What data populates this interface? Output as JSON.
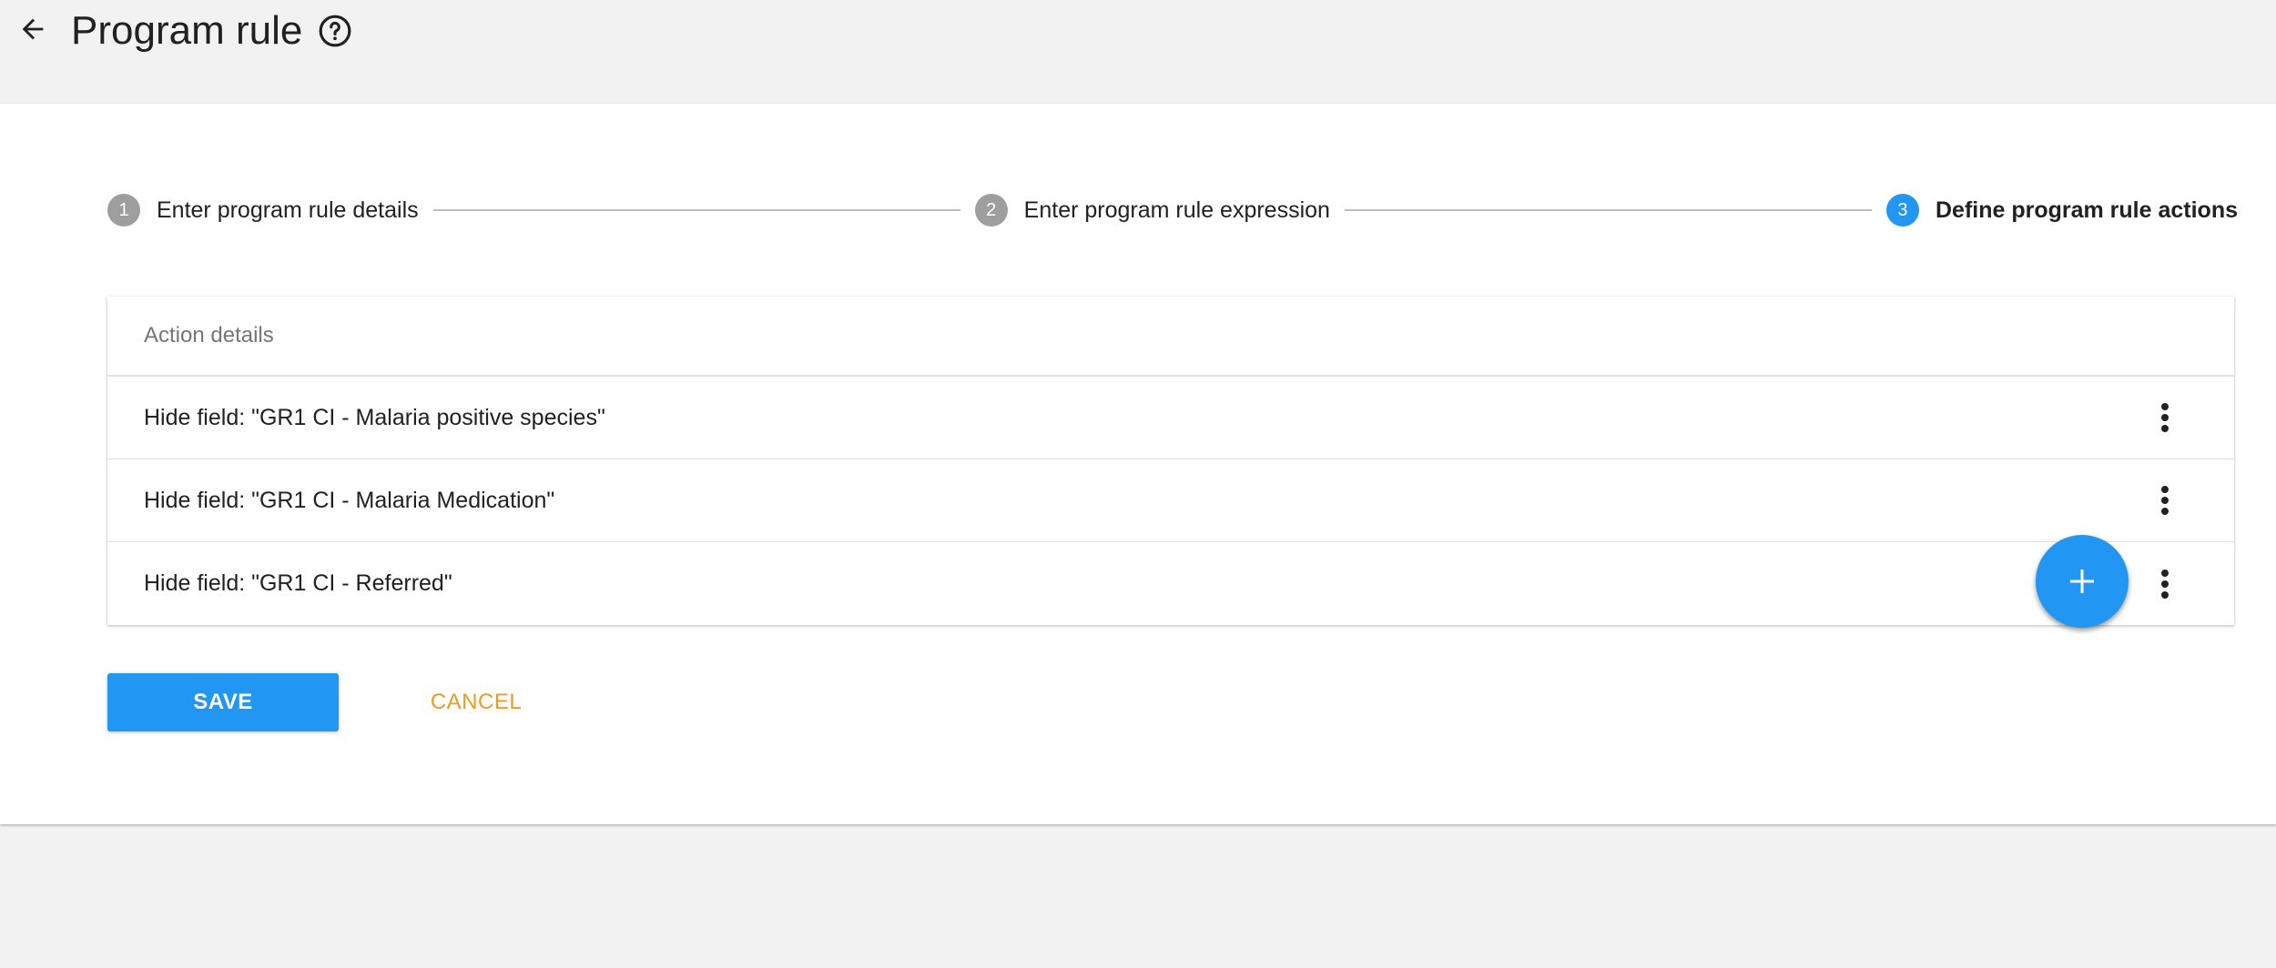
{
  "header": {
    "title": "Program rule",
    "back_icon": "arrow-left-icon",
    "help_icon": "help-circle-icon"
  },
  "stepper": {
    "steps": [
      {
        "number": "1",
        "label": "Enter program rule details",
        "state": "inactive"
      },
      {
        "number": "2",
        "label": "Enter program rule expression",
        "state": "inactive"
      },
      {
        "number": "3",
        "label": "Define program rule actions",
        "state": "active"
      }
    ]
  },
  "actions_table": {
    "header": "Action details",
    "rows": [
      {
        "label": "Hide field: \"GR1 CI - Malaria positive species\""
      },
      {
        "label": "Hide field: \"GR1 CI - Malaria Medication\""
      },
      {
        "label": "Hide field: \"GR1 CI - Referred\""
      }
    ]
  },
  "buttons": {
    "save": "SAVE",
    "cancel": "CANCEL"
  },
  "colors": {
    "primary": "#2196f3",
    "accent": "#ef9a21",
    "step_inactive": "#9e9e9e",
    "background": "#f2f2f2"
  }
}
